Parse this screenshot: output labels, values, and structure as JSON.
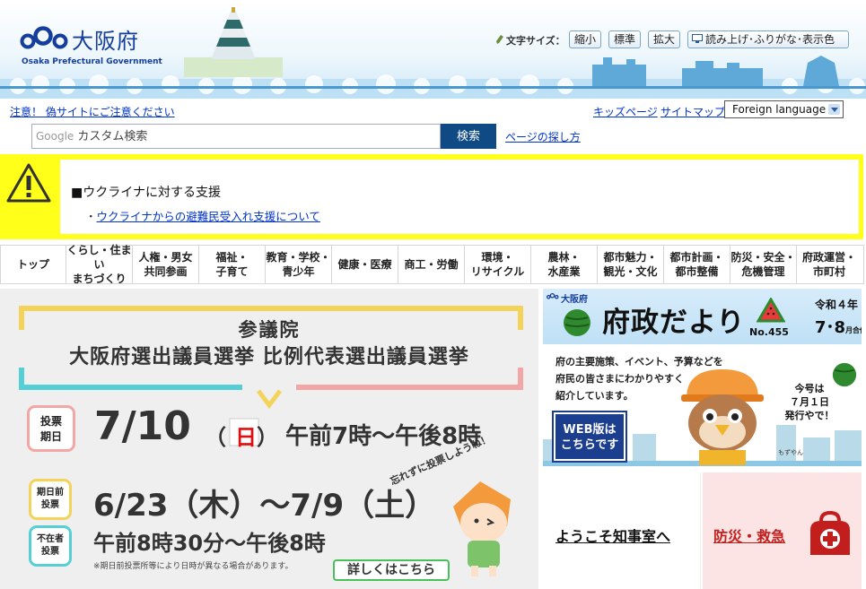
{
  "header": {
    "logo_name": "大阪府",
    "logo_sub": "Osaka Prefectural Government",
    "font_size_label": "文字サイズ：",
    "font_size_buttons": [
      "縮小",
      "標準",
      "拡大"
    ],
    "readout_button": "読み上げ･ふりがな･表示色"
  },
  "utility": {
    "notice": "注意！ 偽サイトにご注意ください",
    "kids": "キッズページ",
    "sitemap": "サイトマップ",
    "language": "Foreign language"
  },
  "search": {
    "google_label": "Google",
    "placeholder": "カスタム検索",
    "button": "検索",
    "find_page": "ページの探し方"
  },
  "alert": {
    "heading": "■ウクライナに対する支援",
    "bullet": "・",
    "item": "ウクライナからの避難民受入れ支援について"
  },
  "nav": [
    "トップ",
    "くらし・住まい\nまちづくり",
    "人権・男女\n共同参画",
    "福祉・\n子育て",
    "教育・学校・\n青少年",
    "健康・医療",
    "商工・労働",
    "環境・\nリサイクル",
    "農林・\n水産業",
    "都市魅力・\n観光・文化",
    "都市計画・\n都市整備",
    "防災・安全・\n危機管理",
    "府政運営・\n市町村"
  ],
  "election": {
    "chamber": "参議院",
    "title": "大阪府選出議員選挙 比例代表選出議員選挙",
    "vote_label": "投票\n期日",
    "vote_date": "7/10",
    "vote_weekday": "日",
    "vote_paren_open": "（",
    "vote_paren_close": "）",
    "vote_time": "午前7時～午後8時",
    "early_label": "期日前\n投票",
    "absent_label": "不在者\n投票",
    "early_dates": "6/23（木）～7/9（土）",
    "early_time": "午前8時30分～午後8時",
    "note": "※期日前投票所等により日時が異なる場合があります。",
    "slogan": "忘れずに投票しようね！",
    "detail_button": "詳しくはこちら"
  },
  "fusei": {
    "pref": "大阪府",
    "title": "府政だより",
    "number": "No.455",
    "year": "令和４年",
    "month": "7･8",
    "month_suffix": "月合併号",
    "description": "府の主要施策、イベント、予算などを\n府民の皆さまにわかりやすく\n紹介しています。",
    "web_button": "WEB版は\nこちらです",
    "release": "今号は\n７月１日\n発行やで！",
    "mascot_name": "もずやん"
  },
  "cards": {
    "governor": "ようこそ知事室へ",
    "disaster": "防災・救急"
  }
}
